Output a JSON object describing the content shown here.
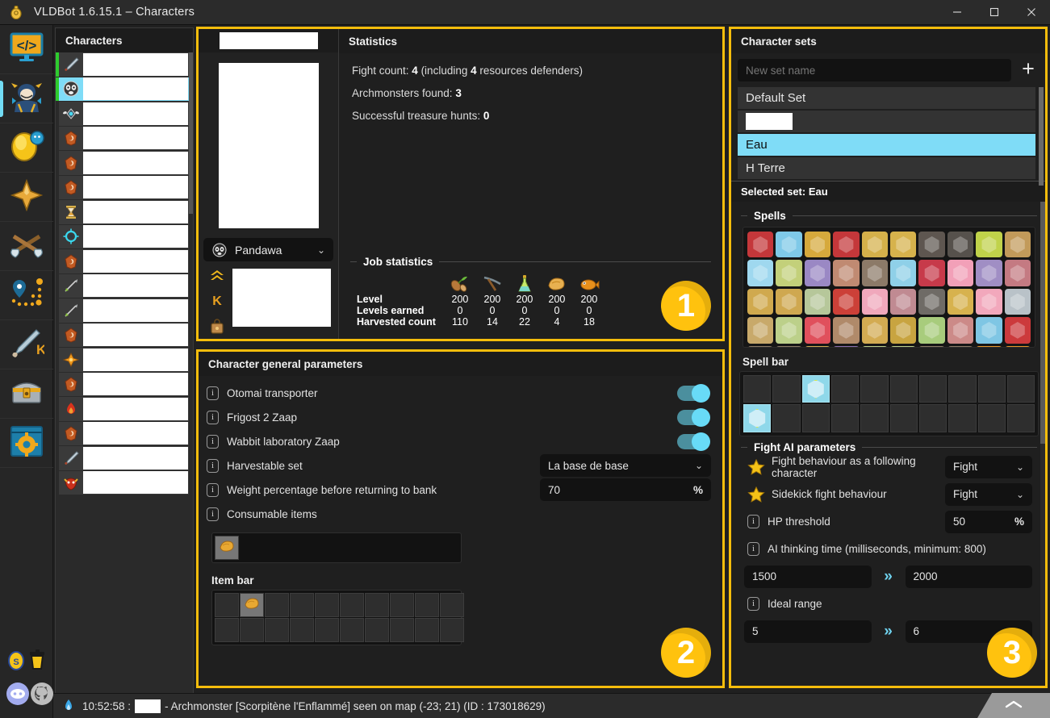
{
  "window": {
    "title": "VLDBot 1.6.15.1 – Characters",
    "app_icon": "bell-icon",
    "controls": [
      {
        "name": "minimize-button",
        "glyph": "—"
      },
      {
        "name": "maximize-button",
        "glyph": "☐"
      },
      {
        "name": "close-button",
        "glyph": "✕"
      }
    ]
  },
  "rail": {
    "items": [
      {
        "name": "sidebar-item-scripts",
        "icon": "code-monitor-icon",
        "active": false
      },
      {
        "name": "sidebar-item-characters",
        "icon": "character-head-icon",
        "active": true
      },
      {
        "name": "sidebar-item-resources",
        "icon": "golden-egg-icon",
        "active": false
      },
      {
        "name": "sidebar-item-achievements",
        "icon": "star-burst-icon",
        "active": false
      },
      {
        "name": "sidebar-item-fights",
        "icon": "crossed-axes-icon",
        "active": false
      },
      {
        "name": "sidebar-item-paths",
        "icon": "map-pin-path-icon",
        "active": false
      },
      {
        "name": "sidebar-item-kolizeum",
        "icon": "sword-k-icon",
        "active": false
      },
      {
        "name": "sidebar-item-treasure",
        "icon": "treasure-chest-icon",
        "active": false
      },
      {
        "name": "sidebar-item-settings",
        "icon": "window-gear-icon",
        "active": false
      }
    ],
    "bottom_items": [
      {
        "name": "donate-icon",
        "icon": "golden-kama-icon"
      },
      {
        "name": "coffee-icon",
        "icon": "coffee-cup-icon"
      },
      {
        "name": "discord-icon",
        "icon": "discord-logo-icon"
      },
      {
        "name": "github-icon",
        "icon": "github-logo-icon"
      }
    ]
  },
  "characters_panel": {
    "title": "Characters",
    "rows": [
      {
        "icon": "sword-icon",
        "online": true,
        "selected": false
      },
      {
        "icon": "panda-mask-icon",
        "online": true,
        "selected": true
      },
      {
        "icon": "winged-gem-icon",
        "online": false,
        "selected": false
      },
      {
        "icon": "orange-shield-icon",
        "online": false,
        "selected": false
      },
      {
        "icon": "orange-shield-icon",
        "online": false,
        "selected": false
      },
      {
        "icon": "orange-shield-icon",
        "online": false,
        "selected": false
      },
      {
        "icon": "hourglass-icon",
        "online": false,
        "selected": false
      },
      {
        "icon": "cyan-ring-icon",
        "online": false,
        "selected": false
      },
      {
        "icon": "orange-shield-icon",
        "online": false,
        "selected": false
      },
      {
        "icon": "arrow-icon",
        "online": false,
        "selected": false
      },
      {
        "icon": "arrow-icon",
        "online": false,
        "selected": false
      },
      {
        "icon": "orange-shield-icon",
        "online": false,
        "selected": false
      },
      {
        "icon": "orange-emblem-icon",
        "online": false,
        "selected": false
      },
      {
        "icon": "orange-shield-icon",
        "online": false,
        "selected": false
      },
      {
        "icon": "red-flame-icon",
        "online": false,
        "selected": false
      },
      {
        "icon": "orange-shield-icon",
        "online": false,
        "selected": false
      },
      {
        "icon": "sword-icon",
        "online": false,
        "selected": false
      },
      {
        "icon": "red-mask-icon",
        "online": false,
        "selected": false
      }
    ]
  },
  "region1": {
    "badge": "1",
    "breed": "Pandawa",
    "breed_icon": "panda-mask-icon",
    "breed_chevron": "⌄",
    "level_icons": [
      "level-up-icon",
      "kamas-k-icon",
      "bag-icon"
    ],
    "statistics": {
      "title": "Statistics",
      "lines": [
        {
          "label": "Fight count: ",
          "value": "4",
          "suffix": " (including ",
          "value2": "4",
          "suffix2": " resources defenders)"
        },
        {
          "label": "Archmonsters found: ",
          "value": "3",
          "suffix": "",
          "value2": "",
          "suffix2": ""
        },
        {
          "label": "Successful treasure hunts: ",
          "value": "0",
          "suffix": "",
          "value2": "",
          "suffix2": ""
        }
      ],
      "job_statistics": {
        "title": "Job statistics",
        "job_icons": [
          "lumberjack-icon",
          "miner-icon",
          "alchemist-icon",
          "baker-icon",
          "fisherman-icon"
        ],
        "rows": [
          {
            "label": "Level",
            "values": [
              "200",
              "200",
              "200",
              "200",
              "200"
            ]
          },
          {
            "label": "Levels earned",
            "values": [
              "0",
              "0",
              "0",
              "0",
              "0"
            ]
          },
          {
            "label": "Harvested count",
            "values": [
              "110",
              "14",
              "22",
              "4",
              "18"
            ]
          }
        ]
      }
    }
  },
  "region2": {
    "badge": "2",
    "title": "Character general parameters",
    "params": [
      {
        "icon": "info-icon",
        "label": "Otomai transporter",
        "control": "toggle",
        "value": "on"
      },
      {
        "icon": "info-icon",
        "label": "Frigost 2 Zaap",
        "control": "toggle",
        "value": "on"
      },
      {
        "icon": "info-icon",
        "label": "Wabbit laboratory Zaap",
        "control": "toggle",
        "value": "on"
      },
      {
        "icon": "info-icon",
        "label": "Harvestable set",
        "control": "select",
        "value": "La base de base",
        "chevron": "⌄"
      },
      {
        "icon": "info-icon",
        "label": "Weight percentage before returning to bank",
        "control": "number",
        "value": "70",
        "unit": "%"
      },
      {
        "icon": "info-icon",
        "label": "Consumable items",
        "control": "none",
        "value": ""
      }
    ],
    "consumable_slots": [
      {
        "filled": true,
        "icon": "bread-icon"
      }
    ],
    "item_bar": {
      "title": "Item bar",
      "slots": [
        {
          "filled": false
        },
        {
          "filled": true,
          "icon": "bread-icon"
        },
        {
          "filled": false
        },
        {
          "filled": false
        },
        {
          "filled": false
        },
        {
          "filled": false
        },
        {
          "filled": false
        },
        {
          "filled": false
        },
        {
          "filled": false
        },
        {
          "filled": false
        },
        {
          "filled": false
        },
        {
          "filled": false
        },
        {
          "filled": false
        },
        {
          "filled": false
        },
        {
          "filled": false
        },
        {
          "filled": false
        },
        {
          "filled": false
        },
        {
          "filled": false
        },
        {
          "filled": false
        },
        {
          "filled": false
        }
      ]
    }
  },
  "region3": {
    "badge": "3",
    "title": "Character sets",
    "new_set_placeholder": "New set name",
    "new_set_value": "",
    "add_button": "+",
    "sets": [
      {
        "label": "Default Set",
        "selected": false,
        "redacted": false
      },
      {
        "label": "",
        "selected": false,
        "redacted": true
      },
      {
        "label": "Eau",
        "selected": true,
        "redacted": false
      },
      {
        "label": "H Terre",
        "selected": false,
        "redacted": false
      }
    ],
    "selected_set_label": "Selected set: Eau",
    "spells_title": "Spells",
    "spell_colors": [
      "#c4373a",
      "#7fc9e8",
      "#d6a93c",
      "#c4373a",
      "#d4b04a",
      "#d6b24c",
      "#5e5650",
      "#56514c",
      "#c0d24a",
      "#c29a5a",
      "#9fd8ef",
      "#c3d07a",
      "#9a88c4",
      "#c08a72",
      "#8c7a68",
      "#8fd0e8",
      "#c73a4a",
      "#f2a0b8",
      "#a08ec4",
      "#c47a82",
      "#d0a94e",
      "#cfa850",
      "#b6c79a",
      "#cc4038",
      "#f0a8bc",
      "#c08a92",
      "#6f6b66",
      "#d7b24e",
      "#f2a8bc",
      "#b9c2c8",
      "#c8a96a",
      "#bcd08a",
      "#e0505c",
      "#b08a6a",
      "#d3ab52",
      "#c8a440",
      "#a8cc7c",
      "#cc8a88",
      "#7fc6e4",
      "#cc3a3c",
      "#8b7b66",
      "#8b7b66",
      "#d3ab52",
      "#8a6fb0",
      "#bcd08a",
      "#bcd08a",
      "#8b7b66",
      "#8b7b66",
      "#e8972a",
      "#e8972a"
    ],
    "spell_bar_title": "Spell bar",
    "spell_bar": [
      {
        "filled": false
      },
      {
        "filled": false
      },
      {
        "filled": true
      },
      {
        "filled": false
      },
      {
        "filled": false
      },
      {
        "filled": false
      },
      {
        "filled": false
      },
      {
        "filled": false
      },
      {
        "filled": false
      },
      {
        "filled": false
      },
      {
        "filled": true
      },
      {
        "filled": false
      },
      {
        "filled": false
      },
      {
        "filled": false
      },
      {
        "filled": false
      },
      {
        "filled": false
      },
      {
        "filled": false
      },
      {
        "filled": false
      },
      {
        "filled": false
      },
      {
        "filled": false
      }
    ],
    "fight_ai": {
      "title": "Fight AI parameters",
      "rows": [
        {
          "icon": "star-icon",
          "label": "Fight behaviour as a following character",
          "control": "select",
          "value": "Fight",
          "chevron": "⌄"
        },
        {
          "icon": "star-icon",
          "label": "Sidekick fight behaviour",
          "control": "select",
          "value": "Fight",
          "chevron": "⌄"
        },
        {
          "icon": "info-icon",
          "label": "HP threshold",
          "control": "number",
          "value": "50",
          "unit": "%"
        },
        {
          "icon": "info-icon",
          "label": "AI thinking time (milliseconds, minimum: 800)",
          "control": "range",
          "min": "1500",
          "max": "2000",
          "arrow": "»"
        },
        {
          "icon": "info-icon",
          "label": "Ideal range",
          "control": "range",
          "min": "5",
          "max": "6",
          "arrow": "»"
        }
      ]
    }
  },
  "status_bar": {
    "icon": "flame-icon",
    "time": "10:52:58 :",
    "message": "- Archmonster [Scorpitène l'Enflammé] seen on map (-23; 21) (ID : 173018629)",
    "expand_icon": "chevron-up-icon"
  },
  "colors": {
    "accent_yellow": "#f5bd0c",
    "badge_yellow": "#ffc20e",
    "selection_cyan": "#7fdcf7",
    "toggle_on": "#68dbf7",
    "online_green": "#2ecb2e"
  }
}
